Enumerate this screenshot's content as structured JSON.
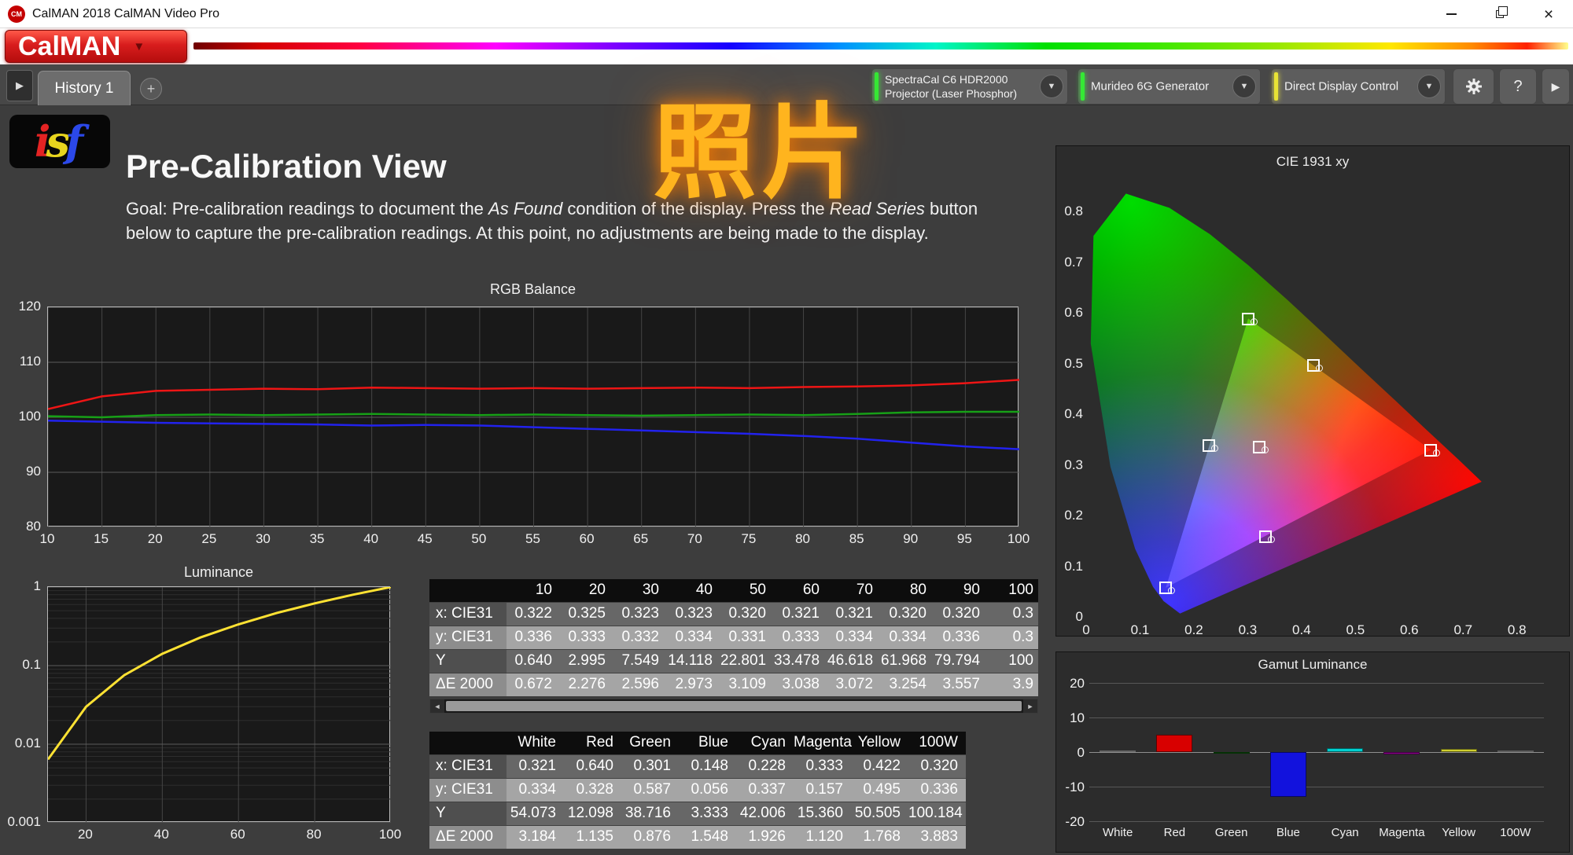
{
  "window": {
    "title": "CalMAN 2018 CalMAN Video Pro",
    "logo_badge": "CM",
    "brand": "CalMAN"
  },
  "icons": {
    "dropdown_caret": "▼",
    "play": "▶",
    "add": "+",
    "help": "?",
    "collapse": "▶",
    "close": "×",
    "scroll_left": "◄",
    "scroll_right": "►"
  },
  "tabs": {
    "history": "History 1"
  },
  "devices": {
    "meter_line1": "SpectraCal C6 HDR2000",
    "meter_line2": "Projector (Laser Phosphor)",
    "generator": "Murideo 6G Generator",
    "display_control": "Direct Display Control"
  },
  "page": {
    "isf_i": "i",
    "isf_s": "s",
    "isf_f": "f",
    "title": "Pre-Calibration View",
    "watermark": "照片",
    "goal": {
      "t1": "Goal: Pre-calibration readings to document the ",
      "italic1": "As Found",
      "t2": " condition of the display. Press the ",
      "italic2": "Read Series",
      "t3": " button",
      "line2": "below to capture the pre-calibration readings. At this point, no adjustments are being made to the display."
    }
  },
  "chart_data": [
    {
      "id": "rgb_balance",
      "type": "line",
      "title": "RGB Balance",
      "xlim": [
        10,
        100
      ],
      "ylim": [
        80,
        120
      ],
      "xticks": [
        10,
        15,
        20,
        25,
        30,
        35,
        40,
        45,
        50,
        55,
        60,
        65,
        70,
        75,
        80,
        85,
        90,
        95,
        100
      ],
      "yticks": [
        80,
        90,
        100,
        110,
        120
      ],
      "x": [
        10,
        15,
        20,
        25,
        30,
        35,
        40,
        45,
        50,
        55,
        60,
        65,
        70,
        75,
        80,
        85,
        90,
        95,
        100
      ],
      "series": [
        {
          "name": "Red",
          "color": "#ee1515",
          "values": [
            101.5,
            103.8,
            104.8,
            105.0,
            105.2,
            105.1,
            105.4,
            105.3,
            105.2,
            105.3,
            105.2,
            105.3,
            105.4,
            105.3,
            105.5,
            105.6,
            105.8,
            106.2,
            106.8
          ]
        },
        {
          "name": "Green",
          "color": "#17a017",
          "values": [
            100.2,
            100.0,
            100.4,
            100.5,
            100.4,
            100.5,
            100.6,
            100.5,
            100.4,
            100.5,
            100.4,
            100.3,
            100.4,
            100.5,
            100.4,
            100.6,
            100.9,
            101.0,
            101.0
          ]
        },
        {
          "name": "Blue",
          "color": "#2222ee",
          "values": [
            99.4,
            99.2,
            99.0,
            98.9,
            98.8,
            98.7,
            98.5,
            98.6,
            98.5,
            98.2,
            97.9,
            97.6,
            97.3,
            97.0,
            96.6,
            96.1,
            95.4,
            94.7,
            94.2
          ]
        }
      ]
    },
    {
      "id": "luminance",
      "type": "line",
      "title": "Luminance",
      "xlim": [
        10,
        100
      ],
      "ylim": [
        0.001,
        1
      ],
      "yscale": "log",
      "xticks": [
        20,
        40,
        60,
        80,
        100
      ],
      "yticks": [
        1,
        0.1,
        0.01,
        0.001
      ],
      "x": [
        10,
        20,
        30,
        40,
        50,
        60,
        70,
        80,
        90,
        100
      ],
      "series": [
        {
          "name": "Luminance",
          "color": "#ffe233",
          "values": [
            0.0064,
            0.02995,
            0.07549,
            0.14118,
            0.22801,
            0.33478,
            0.46618,
            0.61968,
            0.79794,
            1.0
          ]
        }
      ]
    },
    {
      "id": "cie1931",
      "type": "scatter",
      "title": "CIE 1931 xy",
      "xlim": [
        0,
        0.85
      ],
      "ylim": [
        0,
        0.85
      ],
      "xticks": [
        0,
        0.1,
        0.2,
        0.3,
        0.4,
        0.5,
        0.6,
        0.7,
        0.8
      ],
      "yticks": [
        0,
        0.1,
        0.2,
        0.3,
        0.4,
        0.5,
        0.6,
        0.7,
        0.8
      ],
      "points": [
        {
          "name": "White",
          "x": 0.321,
          "y": 0.334
        },
        {
          "name": "Red",
          "x": 0.64,
          "y": 0.328
        },
        {
          "name": "Green",
          "x": 0.301,
          "y": 0.587
        },
        {
          "name": "Blue",
          "x": 0.148,
          "y": 0.056
        },
        {
          "name": "Cyan",
          "x": 0.228,
          "y": 0.337
        },
        {
          "name": "Magenta",
          "x": 0.333,
          "y": 0.157
        },
        {
          "name": "Yellow",
          "x": 0.422,
          "y": 0.495
        }
      ]
    },
    {
      "id": "gamut_luminance",
      "type": "bar",
      "title": "Gamut Luminance",
      "categories": [
        "White",
        "Red",
        "Green",
        "Blue",
        "Cyan",
        "Magenta",
        "Yellow",
        "100W"
      ],
      "values": [
        0.4,
        5.0,
        -0.4,
        -13.0,
        1.2,
        -0.6,
        0.9,
        0.4
      ],
      "colors": [
        "#e0e0e0",
        "#d80000",
        "#0b6b0b",
        "#1212dd",
        "#00cfcf",
        "#8b008b",
        "#cfcf30",
        "#cccccc"
      ],
      "ylim": [
        -20,
        20
      ],
      "yticks": [
        -20,
        -10,
        0,
        10,
        20
      ]
    }
  ],
  "tables": {
    "grayscale": {
      "columns": [
        "",
        "10",
        "20",
        "30",
        "40",
        "50",
        "60",
        "70",
        "80",
        "90",
        "100"
      ],
      "rows": [
        {
          "label": "x: CIE31",
          "values": [
            "0.322",
            "0.325",
            "0.323",
            "0.323",
            "0.320",
            "0.321",
            "0.321",
            "0.320",
            "0.320",
            "0.3"
          ]
        },
        {
          "label": "y: CIE31",
          "values": [
            "0.336",
            "0.333",
            "0.332",
            "0.334",
            "0.331",
            "0.333",
            "0.334",
            "0.334",
            "0.336",
            "0.3"
          ]
        },
        {
          "label": "Y",
          "values": [
            "0.640",
            "2.995",
            "7.549",
            "14.118",
            "22.801",
            "33.478",
            "46.618",
            "61.968",
            "79.794",
            "100"
          ]
        },
        {
          "label": "ΔE 2000",
          "values": [
            "0.672",
            "2.276",
            "2.596",
            "2.973",
            "3.109",
            "3.038",
            "3.072",
            "3.254",
            "3.557",
            "3.9"
          ]
        }
      ]
    },
    "gamut": {
      "columns": [
        "",
        "White",
        "Red",
        "Green",
        "Blue",
        "Cyan",
        "Magenta",
        "Yellow",
        "100W"
      ],
      "rows": [
        {
          "label": "x: CIE31",
          "values": [
            "0.321",
            "0.640",
            "0.301",
            "0.148",
            "0.228",
            "0.333",
            "0.422",
            "0.320"
          ]
        },
        {
          "label": "y: CIE31",
          "values": [
            "0.334",
            "0.328",
            "0.587",
            "0.056",
            "0.337",
            "0.157",
            "0.495",
            "0.336"
          ]
        },
        {
          "label": "Y",
          "values": [
            "54.073",
            "12.098",
            "38.716",
            "3.333",
            "42.006",
            "15.360",
            "50.505",
            "100.184"
          ]
        },
        {
          "label": "ΔE 2000",
          "values": [
            "3.184",
            "1.135",
            "0.876",
            "1.548",
            "1.926",
            "1.120",
            "1.768",
            "3.883"
          ]
        }
      ]
    }
  }
}
